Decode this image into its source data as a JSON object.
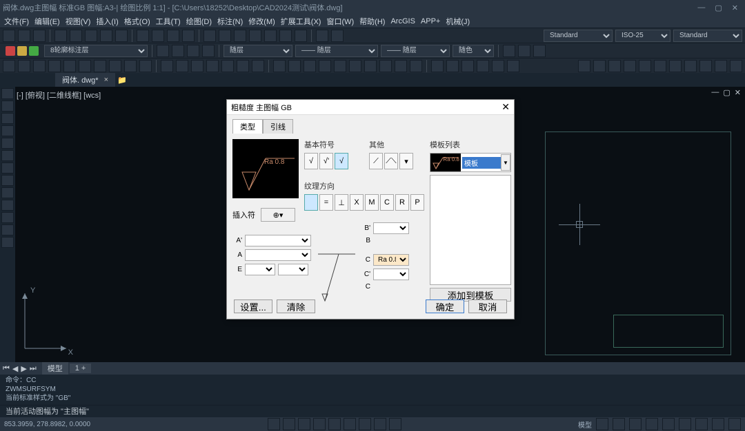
{
  "window": {
    "title": "阀体.dwg主图幅 标准GB 图幅:A3-| 绘图比例 1:1] - [C:\\Users\\18252\\Desktop\\CAD2024测试\\阀体.dwg]"
  },
  "menu": {
    "items": [
      "文件(F)",
      "编辑(E)",
      "视图(V)",
      "插入(I)",
      "格式(O)",
      "工具(T)",
      "绘图(D)",
      "标注(N)",
      "修改(M)",
      "扩展工具(X)",
      "窗口(W)",
      "帮助(H)",
      "ArcGIS",
      "APP+",
      "机械(J)"
    ]
  },
  "layer_select": "8轮廓标注层",
  "style_select_1": "Standard",
  "style_select_2": "ISO-25",
  "style_select_3": "Standard",
  "doc_tab": "阀体. dwg*",
  "ws_label": "[-] [俯视] [二维线框] [wcs]",
  "axis": {
    "x": "X",
    "y": "Y"
  },
  "model_tabs": {
    "model": "模型",
    "plus": "1    +"
  },
  "cmd": {
    "line1": "命令：CC",
    "line2": "ZWMSURFSYM",
    "line3": "当前标准样式为 \"GB\"",
    "line4": "当前活动图幅为 \"主图幅\""
  },
  "status": {
    "coords": "853.3959, 278.8982, 0.0000",
    "right": "模型"
  },
  "dialog": {
    "title": "粗糙度 主图幅 GB",
    "tabs": {
      "t1": "类型",
      "t2": "引线"
    },
    "section_basic": "基本符号",
    "section_other": "其他",
    "section_templ": "模板列表",
    "section_dir": "纹理方向",
    "dir_btns": [
      "",
      "=",
      "⊥",
      "X",
      "M",
      "C",
      "R",
      "P"
    ],
    "insert_label": "插入符",
    "insert_toggle": "⊕",
    "params": {
      "a1": "A'",
      "a": "A",
      "e": "E",
      "b1": "B'",
      "b": "B",
      "c1": "C",
      "c2": "C'",
      "c3": "C",
      "c1_val": "Ra 0.8"
    },
    "templ_label": "模板",
    "templ_mini_ra": "Ra 0.8",
    "add_templ": "添加到模板",
    "footer": {
      "settings": "设置...",
      "clear": "清除",
      "ok": "确定",
      "cancel": "取消"
    },
    "preview_ra": "Ra 0.8"
  }
}
